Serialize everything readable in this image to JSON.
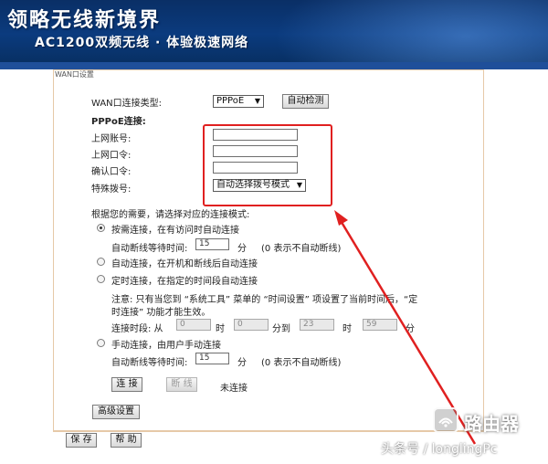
{
  "banner": {
    "title": "领略无线新境界",
    "subtitle": "AC1200双频无线 · 体验极速网络"
  },
  "panel": {
    "title": "WAN口设置"
  },
  "wan": {
    "type_label": "WAN口连接类型:",
    "type_value": "PPPoE",
    "detect_button": "自动检测",
    "pppoe_heading": "PPPoE连接:",
    "account_label": "上网账号:",
    "password_label": "上网口令:",
    "confirm_label": "确认口令:",
    "dial_label": "特殊拨号:",
    "dial_value": "自动选择拨号模式"
  },
  "mode": {
    "prompt": "根据您的需要，请选择对应的连接模式:",
    "on_demand": "按需连接，在有访问时自动连接",
    "idle_label": "自动断线等待时间:",
    "idle_value": "15",
    "idle_unit": "分",
    "idle_hint": "(0 表示不自动断线)",
    "auto_connect": "自动连接，在开机和断线后自动连接",
    "scheduled": "定时连接，在指定的时间段自动连接",
    "note_line1": "注意: 只有当您到 “系统工具” 菜单的 “时间设置” 项设置了当前时间后，“定",
    "note_line2": "时连接” 功能才能生效。",
    "period_label": "连接时段: 从",
    "from_hour": "0",
    "hour_unit": "时",
    "from_min": "0",
    "to_label": "分到",
    "to_hour": "23",
    "to_min": "59",
    "min_unit": "分",
    "manual": "手动连接，由用户手动连接",
    "idle2_label": "自动断线等待时间:",
    "idle2_value": "15",
    "idle2_unit": "分",
    "idle2_hint": "(0 表示不自动断线)",
    "connect_button": "连 接",
    "disconnect_button": "断 线",
    "status": "未连接",
    "advanced_button": "高级设置"
  },
  "footer": {
    "save_button": "保 存",
    "help_button": "帮 助"
  },
  "watermark": {
    "brand": "路由器",
    "credit": "头条号 / longlingPc"
  },
  "colors": {
    "banner": "#0b3b7e",
    "highlight": "#e02020",
    "arrow": "#e02020"
  }
}
